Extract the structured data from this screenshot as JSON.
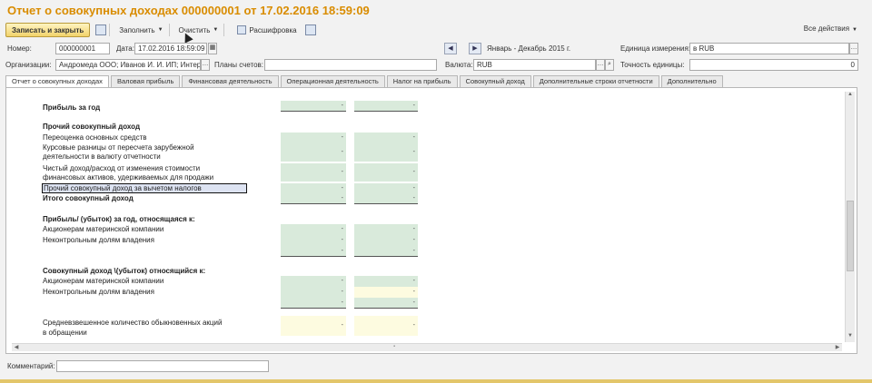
{
  "window": {
    "title": "Отчет о совокупных доходах 000000001 от 17.02.2016 18:59:09"
  },
  "toolbar": {
    "save_close": "Записать и закрыть",
    "fill": "Заполнить",
    "clear": "Очистить",
    "decode": "Расшифровка",
    "all_actions": "Все действия"
  },
  "header": {
    "number_label": "Номер:",
    "number_value": "000000001",
    "date_label": "Дата:",
    "date_value": "17.02.2016 18:59:09",
    "period_value": "Январь - Декабрь 2015 г.",
    "unit_label": "Единица измерения:",
    "unit_value": "в RUB",
    "org_label": "Организации:",
    "org_value": "Андромеда ООО; Иванов И. И. ИП; Интер:",
    "plans_label": "Планы счетов:",
    "plans_value": "",
    "currency_label": "Валюта:",
    "currency_value": "RUB",
    "precision_label": "Точность единицы:",
    "precision_value": "0"
  },
  "tabs": [
    "Отчет о совокупных доходах",
    "Валовая прибыль",
    "Финансовая деятельность",
    "Операционная деятельность",
    "Налог на прибыль",
    "Совокупный доход",
    "Дополнительные строки отчетности",
    "Дополнительно"
  ],
  "report": {
    "dash": "-",
    "profit_year": "Прибыль за год",
    "oci_header": "Прочий совокупный доход",
    "revaluation": "Переоценка основных средств",
    "fx_line1": "Курсовые разницы от пересчета зарубежной",
    "fx_line2": "деятельности в валюту отчетности",
    "net_line1": "Чистый доход/расход от изменения стоимости",
    "net_line2": "финансовых активов, удерживаемых для продажи",
    "oci_net": "Прочий совокупный доход за вычетом налогов",
    "total_ci": "Итого совокупный доход",
    "profit_attr": "Прибыль/ (убыток) за год, относящаяся к:",
    "parent_1": "Акционерам материнской компании",
    "minority_1": "Неконтрольным долям владения",
    "ci_attr": "Совокупный доход \\(убыток) относящийся к:",
    "parent_2": "Акционерам материнской компании",
    "minority_2": "Неконтрольным долям владения",
    "wavg_line1": "Средневзвешенное количество обыкновенных акций",
    "wavg_line2": "в обращении"
  },
  "footer": {
    "comment_label": "Комментарий:",
    "comment_value": ""
  }
}
